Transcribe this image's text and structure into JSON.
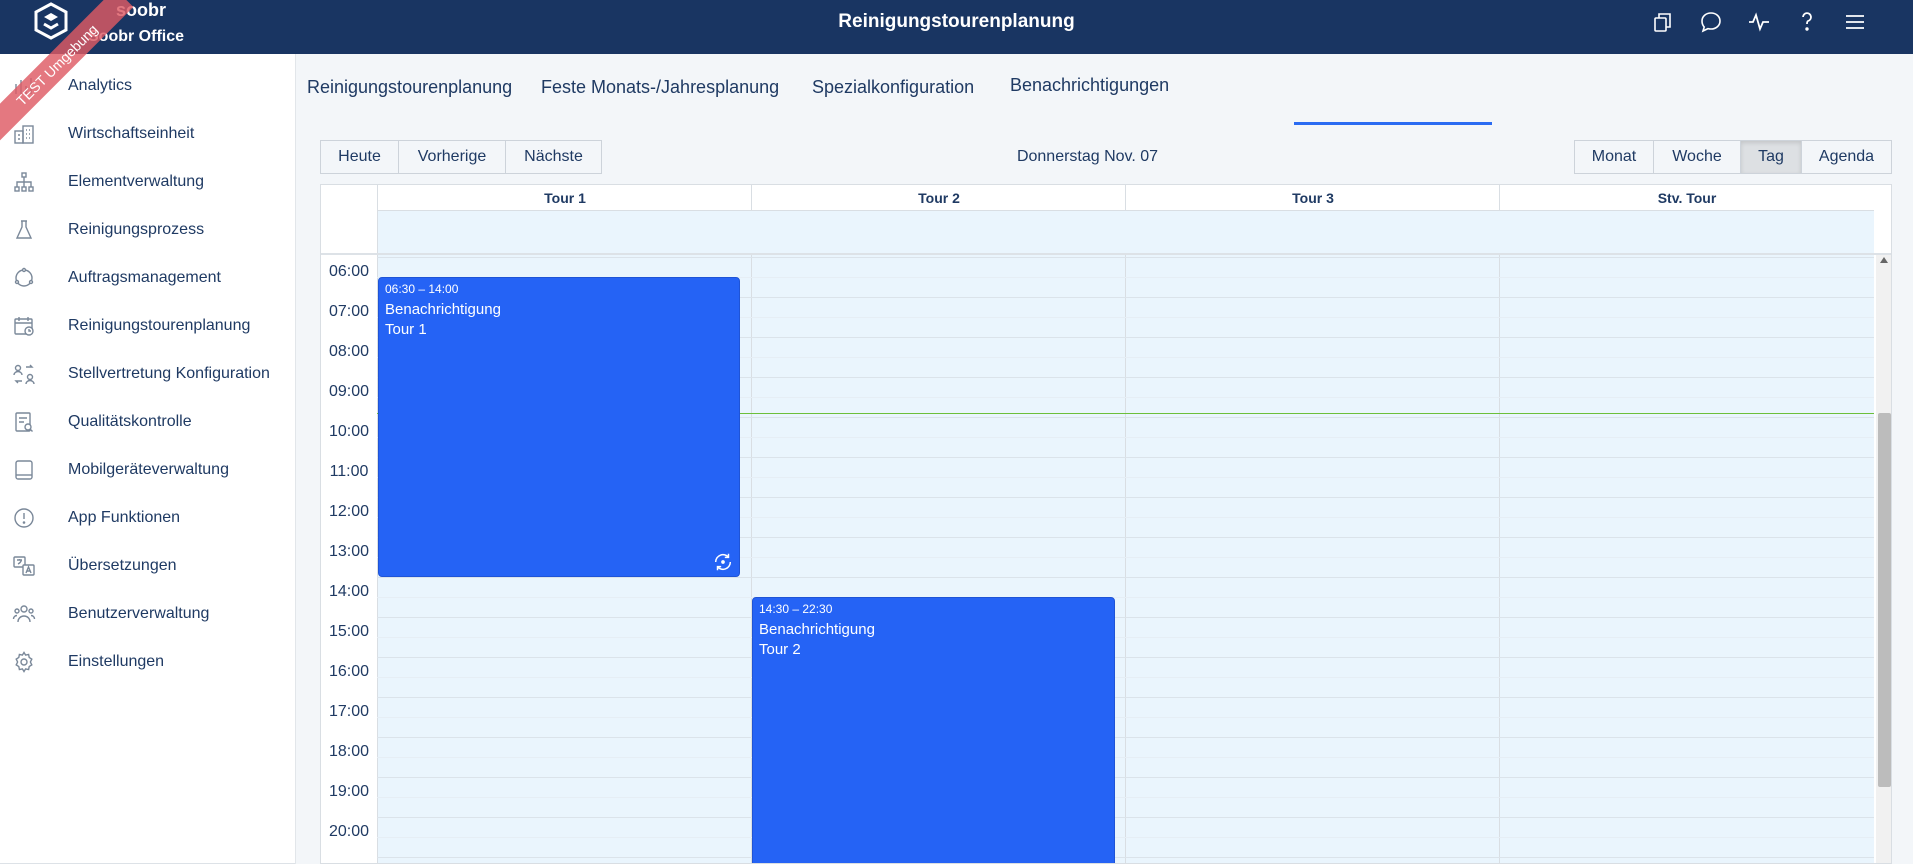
{
  "header": {
    "brand_name": "soobr",
    "brand_subtitle": "Soobr Office",
    "env_ribbon": "TEST Umgebung",
    "title": "Reinigungstourenplanung",
    "icons": [
      "copy-icon",
      "chat-icon",
      "activity-icon",
      "help-icon",
      "menu-icon"
    ]
  },
  "sidebar": {
    "items": [
      {
        "label": "Analytics",
        "icon": "analytics-icon"
      },
      {
        "label": "Wirtschaftseinheit",
        "icon": "building-icon"
      },
      {
        "label": "Elementverwaltung",
        "icon": "hierarchy-icon"
      },
      {
        "label": "Reinigungsprozess",
        "icon": "flask-icon"
      },
      {
        "label": "Auftragsmanagement",
        "icon": "cycle-icon"
      },
      {
        "label": "Reinigungstourenplanung",
        "icon": "calendar-clock-icon"
      },
      {
        "label": "Stellvertretung Konfiguration",
        "icon": "swap-users-icon"
      },
      {
        "label": "Qualitätskontrolle",
        "icon": "checklist-icon"
      },
      {
        "label": "Mobilgeräteverwaltung",
        "icon": "tablet-icon"
      },
      {
        "label": "App Funktionen",
        "icon": "alert-circle-icon"
      },
      {
        "label": "Übersetzungen",
        "icon": "translate-icon"
      },
      {
        "label": "Benutzerverwaltung",
        "icon": "users-icon"
      },
      {
        "label": "Einstellungen",
        "icon": "gear-icon"
      }
    ]
  },
  "tabs": [
    {
      "label": "Reinigungstourenplanung",
      "active": false
    },
    {
      "label": "Feste Monats-/Jahresplanung",
      "active": false
    },
    {
      "label": "Spezialkonfiguration",
      "active": false
    },
    {
      "label": "Benachrichtigungen",
      "active": true
    }
  ],
  "toolbar": {
    "today": "Heute",
    "previous": "Vorherige",
    "next": "Nächste",
    "date": "Donnerstag Nov. 07",
    "views": [
      "Monat",
      "Woche",
      "Tag",
      "Agenda"
    ],
    "active_view": "Tag"
  },
  "calendar": {
    "columns": [
      "Tour 1",
      "Tour 2",
      "Tour 3",
      "Stv. Tour"
    ],
    "hours": [
      "06:00",
      "07:00",
      "08:00",
      "09:00",
      "10:00",
      "11:00",
      "12:00",
      "13:00",
      "14:00",
      "15:00",
      "16:00",
      "17:00",
      "18:00",
      "19:00",
      "20:00"
    ],
    "events": [
      {
        "time": "06:30 – 14:00",
        "line1": "Benachrichtigung",
        "line2": "Tour 1",
        "column": "Tour 1",
        "recurring": true
      },
      {
        "time": "14:30 – 22:30",
        "line1": "Benachrichtigung",
        "line2": "Tour 2",
        "column": "Tour 2",
        "recurring": false
      }
    ],
    "now_line_color": "#6cbf3a",
    "event_color": "#2563f5"
  }
}
